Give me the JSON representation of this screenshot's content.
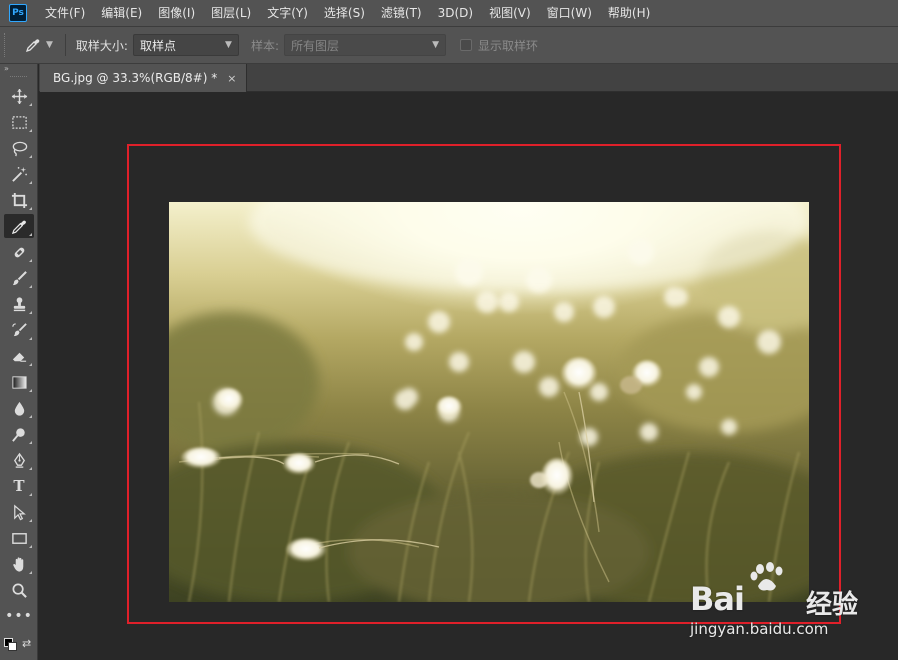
{
  "app": {
    "logo": "Ps"
  },
  "menu": [
    {
      "label": "文件(F)"
    },
    {
      "label": "编辑(E)"
    },
    {
      "label": "图像(I)"
    },
    {
      "label": "图层(L)"
    },
    {
      "label": "文字(Y)"
    },
    {
      "label": "选择(S)"
    },
    {
      "label": "滤镜(T)"
    },
    {
      "label": "3D(D)"
    },
    {
      "label": "视图(V)"
    },
    {
      "label": "窗口(W)"
    },
    {
      "label": "帮助(H)"
    }
  ],
  "options": {
    "sample_size_label": "取样大小:",
    "sample_size_value": "取样点",
    "sample_label": "样本:",
    "sample_value": "所有图层",
    "show_ring_label": "显示取样环"
  },
  "toolbar": {
    "collapse_glyph": "»",
    "active_tool": "eyedropper-tool",
    "tools": [
      "move-tool",
      "marquee-tool",
      "lasso-tool",
      "magic-wand-tool",
      "crop-tool",
      "eyedropper-tool",
      "healing-brush-tool",
      "brush-tool",
      "clone-stamp-tool",
      "history-brush-tool",
      "eraser-tool",
      "gradient-tool",
      "blur-tool",
      "dodge-tool",
      "pen-tool",
      "type-tool",
      "path-selection-tool",
      "rectangle-tool",
      "hand-tool",
      "zoom-tool",
      "edit-toolbar"
    ],
    "type_glyph": "T",
    "more_glyph": "•••",
    "foreground_color": "#000000",
    "background_color": "#ffffff"
  },
  "document": {
    "tab_title": "BG.jpg @ 33.3%(RGB/8#) *",
    "close_glyph": "×"
  },
  "annotation": {
    "highlight_color": "#e0202a"
  },
  "watermark": {
    "brand": "Bai",
    "brand2": "经验",
    "url": "jingyan.baidu.com"
  }
}
